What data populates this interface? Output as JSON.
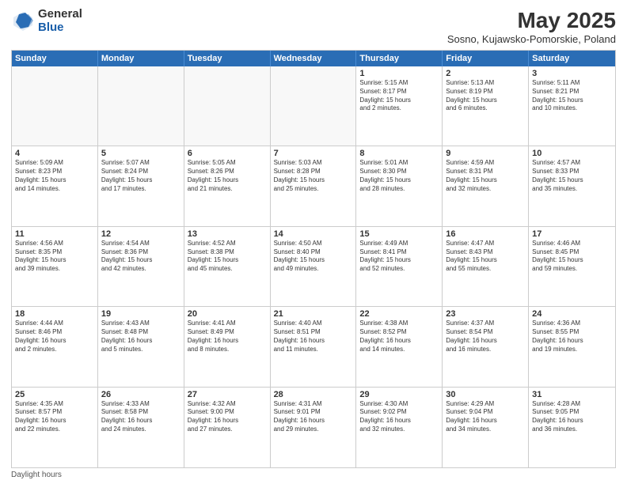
{
  "header": {
    "logo_general": "General",
    "logo_blue": "Blue",
    "title": "May 2025",
    "subtitle": "Sosno, Kujawsko-Pomorskie, Poland"
  },
  "columns": [
    "Sunday",
    "Monday",
    "Tuesday",
    "Wednesday",
    "Thursday",
    "Friday",
    "Saturday"
  ],
  "weeks": [
    [
      {
        "day": "",
        "content": ""
      },
      {
        "day": "",
        "content": ""
      },
      {
        "day": "",
        "content": ""
      },
      {
        "day": "",
        "content": ""
      },
      {
        "day": "1",
        "content": "Sunrise: 5:15 AM\nSunset: 8:17 PM\nDaylight: 15 hours\nand 2 minutes."
      },
      {
        "day": "2",
        "content": "Sunrise: 5:13 AM\nSunset: 8:19 PM\nDaylight: 15 hours\nand 6 minutes."
      },
      {
        "day": "3",
        "content": "Sunrise: 5:11 AM\nSunset: 8:21 PM\nDaylight: 15 hours\nand 10 minutes."
      }
    ],
    [
      {
        "day": "4",
        "content": "Sunrise: 5:09 AM\nSunset: 8:23 PM\nDaylight: 15 hours\nand 14 minutes."
      },
      {
        "day": "5",
        "content": "Sunrise: 5:07 AM\nSunset: 8:24 PM\nDaylight: 15 hours\nand 17 minutes."
      },
      {
        "day": "6",
        "content": "Sunrise: 5:05 AM\nSunset: 8:26 PM\nDaylight: 15 hours\nand 21 minutes."
      },
      {
        "day": "7",
        "content": "Sunrise: 5:03 AM\nSunset: 8:28 PM\nDaylight: 15 hours\nand 25 minutes."
      },
      {
        "day": "8",
        "content": "Sunrise: 5:01 AM\nSunset: 8:30 PM\nDaylight: 15 hours\nand 28 minutes."
      },
      {
        "day": "9",
        "content": "Sunrise: 4:59 AM\nSunset: 8:31 PM\nDaylight: 15 hours\nand 32 minutes."
      },
      {
        "day": "10",
        "content": "Sunrise: 4:57 AM\nSunset: 8:33 PM\nDaylight: 15 hours\nand 35 minutes."
      }
    ],
    [
      {
        "day": "11",
        "content": "Sunrise: 4:56 AM\nSunset: 8:35 PM\nDaylight: 15 hours\nand 39 minutes."
      },
      {
        "day": "12",
        "content": "Sunrise: 4:54 AM\nSunset: 8:36 PM\nDaylight: 15 hours\nand 42 minutes."
      },
      {
        "day": "13",
        "content": "Sunrise: 4:52 AM\nSunset: 8:38 PM\nDaylight: 15 hours\nand 45 minutes."
      },
      {
        "day": "14",
        "content": "Sunrise: 4:50 AM\nSunset: 8:40 PM\nDaylight: 15 hours\nand 49 minutes."
      },
      {
        "day": "15",
        "content": "Sunrise: 4:49 AM\nSunset: 8:41 PM\nDaylight: 15 hours\nand 52 minutes."
      },
      {
        "day": "16",
        "content": "Sunrise: 4:47 AM\nSunset: 8:43 PM\nDaylight: 15 hours\nand 55 minutes."
      },
      {
        "day": "17",
        "content": "Sunrise: 4:46 AM\nSunset: 8:45 PM\nDaylight: 15 hours\nand 59 minutes."
      }
    ],
    [
      {
        "day": "18",
        "content": "Sunrise: 4:44 AM\nSunset: 8:46 PM\nDaylight: 16 hours\nand 2 minutes."
      },
      {
        "day": "19",
        "content": "Sunrise: 4:43 AM\nSunset: 8:48 PM\nDaylight: 16 hours\nand 5 minutes."
      },
      {
        "day": "20",
        "content": "Sunrise: 4:41 AM\nSunset: 8:49 PM\nDaylight: 16 hours\nand 8 minutes."
      },
      {
        "day": "21",
        "content": "Sunrise: 4:40 AM\nSunset: 8:51 PM\nDaylight: 16 hours\nand 11 minutes."
      },
      {
        "day": "22",
        "content": "Sunrise: 4:38 AM\nSunset: 8:52 PM\nDaylight: 16 hours\nand 14 minutes."
      },
      {
        "day": "23",
        "content": "Sunrise: 4:37 AM\nSunset: 8:54 PM\nDaylight: 16 hours\nand 16 minutes."
      },
      {
        "day": "24",
        "content": "Sunrise: 4:36 AM\nSunset: 8:55 PM\nDaylight: 16 hours\nand 19 minutes."
      }
    ],
    [
      {
        "day": "25",
        "content": "Sunrise: 4:35 AM\nSunset: 8:57 PM\nDaylight: 16 hours\nand 22 minutes."
      },
      {
        "day": "26",
        "content": "Sunrise: 4:33 AM\nSunset: 8:58 PM\nDaylight: 16 hours\nand 24 minutes."
      },
      {
        "day": "27",
        "content": "Sunrise: 4:32 AM\nSunset: 9:00 PM\nDaylight: 16 hours\nand 27 minutes."
      },
      {
        "day": "28",
        "content": "Sunrise: 4:31 AM\nSunset: 9:01 PM\nDaylight: 16 hours\nand 29 minutes."
      },
      {
        "day": "29",
        "content": "Sunrise: 4:30 AM\nSunset: 9:02 PM\nDaylight: 16 hours\nand 32 minutes."
      },
      {
        "day": "30",
        "content": "Sunrise: 4:29 AM\nSunset: 9:04 PM\nDaylight: 16 hours\nand 34 minutes."
      },
      {
        "day": "31",
        "content": "Sunrise: 4:28 AM\nSunset: 9:05 PM\nDaylight: 16 hours\nand 36 minutes."
      }
    ]
  ],
  "footer": "Daylight hours"
}
